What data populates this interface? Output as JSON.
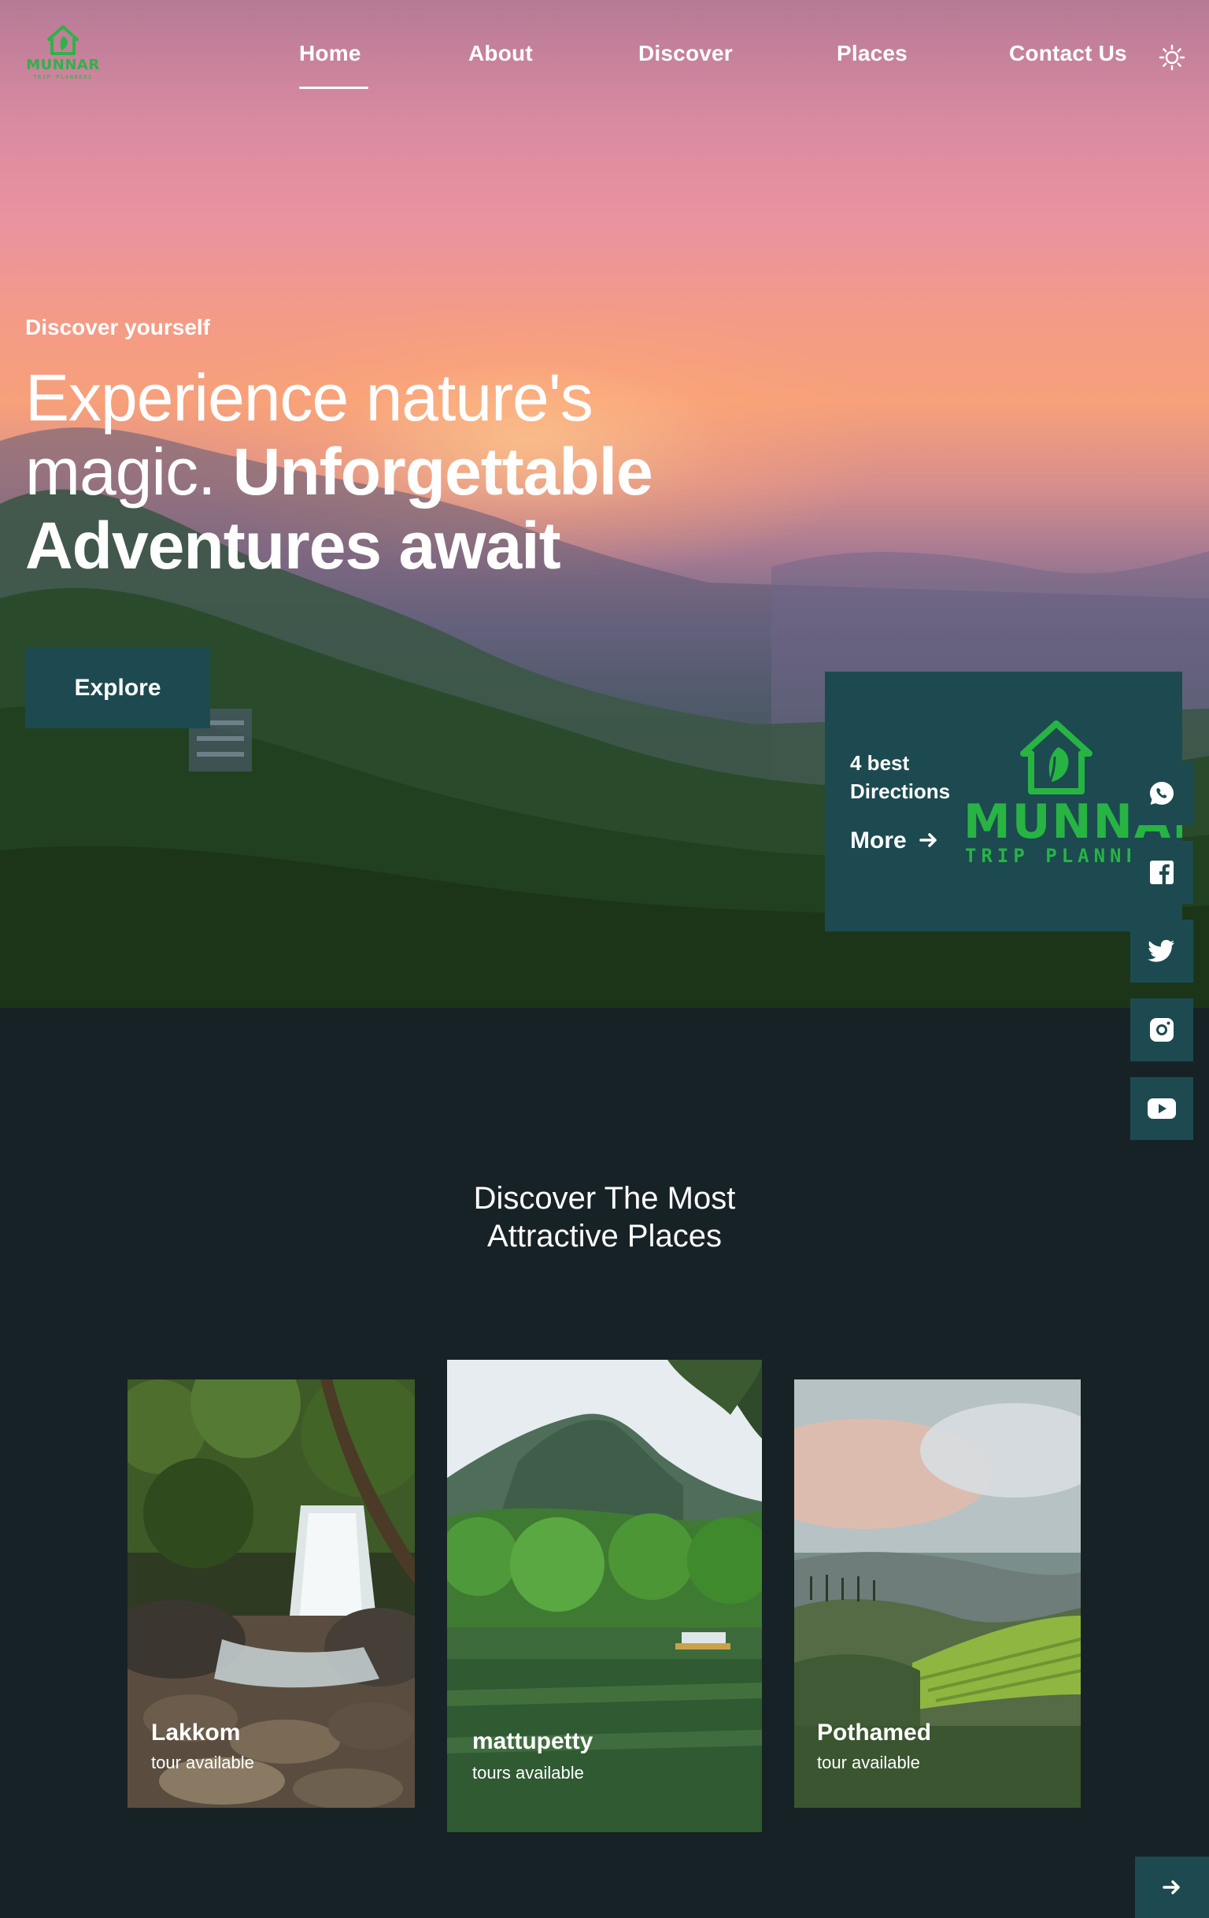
{
  "nav": {
    "logo": {
      "brand": "MUNNAR",
      "tagline": "TRIP PLANNERS"
    },
    "items": [
      {
        "label": "Home",
        "active": true
      },
      {
        "label": "About"
      },
      {
        "label": "Discover"
      },
      {
        "label": "Places"
      },
      {
        "label": "Contact Us"
      }
    ],
    "theme_icon": "sun-icon"
  },
  "hero": {
    "subtitle": "Discover yourself",
    "title_light_1": "Experience nature's",
    "title_light_2": "magic.",
    "title_bold_1": "Unforgettable",
    "title_bold_2": "Adventures await",
    "explore_label": "Explore"
  },
  "directions_card": {
    "line1": "4 best",
    "line2": "Directions",
    "more_label": "More",
    "logo_brand": "MUNNAR",
    "logo_tagline": "TRIP PLANNERS"
  },
  "social": [
    "whatsapp-icon",
    "facebook-icon",
    "twitter-icon",
    "instagram-icon",
    "youtube-icon"
  ],
  "section": {
    "title_line1": "Discover The Most",
    "title_line2": "Attractive Places"
  },
  "places": [
    {
      "name": "Lakkom",
      "subtitle": "tour available"
    },
    {
      "name": "mattupetty",
      "subtitle": "tours available"
    },
    {
      "name": "Pothamed",
      "subtitle": "tour available"
    }
  ],
  "colors": {
    "accent_teal": "#1c4a50",
    "background": "#172226",
    "brand_green": "#27b443"
  }
}
